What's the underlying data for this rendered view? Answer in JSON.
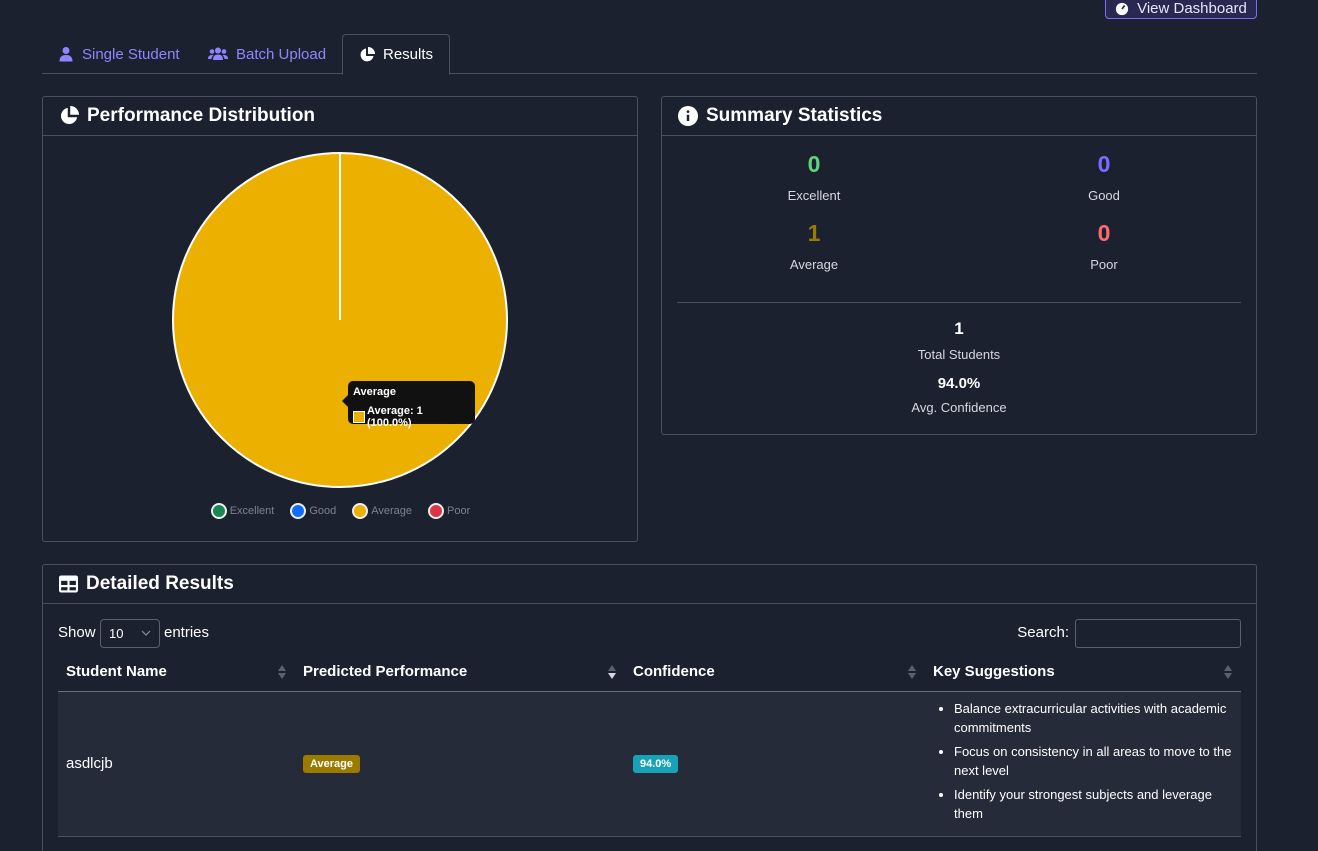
{
  "header": {
    "view_dashboard_label": "View Dashboard"
  },
  "tabs": [
    {
      "label": "Single Student",
      "icon": "user-icon",
      "active": false
    },
    {
      "label": "Batch Upload",
      "icon": "users-icon",
      "active": false
    },
    {
      "label": "Results",
      "icon": "pie-chart-icon",
      "active": true
    }
  ],
  "performance": {
    "title": "Performance Distribution",
    "tooltip": {
      "title": "Average",
      "text": "Average: 1 (100.0%)"
    },
    "legend": [
      {
        "label": "Excellent",
        "color": "#198754"
      },
      {
        "label": "Good",
        "color": "#0d6efd"
      },
      {
        "label": "Average",
        "color": "#ecb000"
      },
      {
        "label": "Poor",
        "color": "#dc3545"
      }
    ]
  },
  "chart_data": {
    "type": "pie",
    "categories": [
      "Excellent",
      "Good",
      "Average",
      "Poor"
    ],
    "values": [
      0,
      0,
      1,
      0
    ],
    "colors": [
      "#198754",
      "#0d6efd",
      "#ecb000",
      "#dc3545"
    ],
    "legend_position": "bottom"
  },
  "summary": {
    "title": "Summary Statistics",
    "excellent": {
      "value": "0",
      "label": "Excellent",
      "color": "#5fd37a"
    },
    "good": {
      "value": "0",
      "label": "Good",
      "color": "#7b6cff"
    },
    "average": {
      "value": "1",
      "label": "Average",
      "color": "#9c7a00"
    },
    "poor": {
      "value": "0",
      "label": "Poor",
      "color": "#ff6b6b"
    },
    "total": {
      "value": "1",
      "label": "Total Students"
    },
    "confidence": {
      "value": "94.0%",
      "label": "Avg. Confidence"
    }
  },
  "results": {
    "title": "Detailed Results",
    "show_label": "Show",
    "entries_value": "10",
    "entries_label": "entries",
    "search_label": "Search:",
    "columns": [
      "Student Name",
      "Predicted Performance",
      "Confidence",
      "Key Suggestions"
    ],
    "rows": [
      {
        "name": "asdlcjb",
        "performance": "Average",
        "confidence": "94.0%",
        "suggestions": [
          "Balance extracurricular activities with academic commitments",
          "Focus on consistency in all areas to move to the next level",
          "Identify your strongest subjects and leverage them"
        ]
      }
    ]
  }
}
